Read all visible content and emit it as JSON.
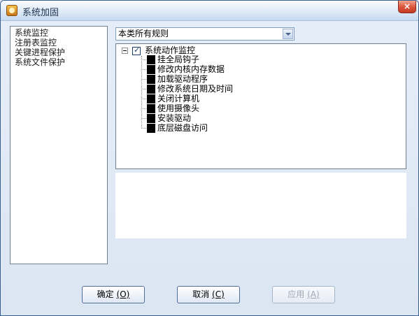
{
  "window": {
    "title": "系统加固",
    "close_label": "×"
  },
  "sidebar": {
    "items": [
      {
        "label": "系统监控"
      },
      {
        "label": "注册表监控"
      },
      {
        "label": "关键进程保护"
      },
      {
        "label": "系统文件保护"
      }
    ]
  },
  "filter": {
    "selected": "本类所有规则"
  },
  "tree": {
    "root": {
      "label": "系统动作监控",
      "expanded": true,
      "checked": true
    },
    "children": [
      {
        "label": "挂全局钩子"
      },
      {
        "label": "修改内核内存数据"
      },
      {
        "label": "加载驱动程序"
      },
      {
        "label": "修改系统日期及时间"
      },
      {
        "label": "关闭计算机"
      },
      {
        "label": "使用摄像头"
      },
      {
        "label": "安装驱动"
      },
      {
        "label": "底层磁盘访问"
      }
    ]
  },
  "buttons": {
    "ok": {
      "label": "确定",
      "hotkey": "(O)"
    },
    "cancel": {
      "label": "取消",
      "hotkey": "(C)"
    },
    "apply": {
      "label": "应用",
      "hotkey": "(A)",
      "enabled": false
    }
  }
}
